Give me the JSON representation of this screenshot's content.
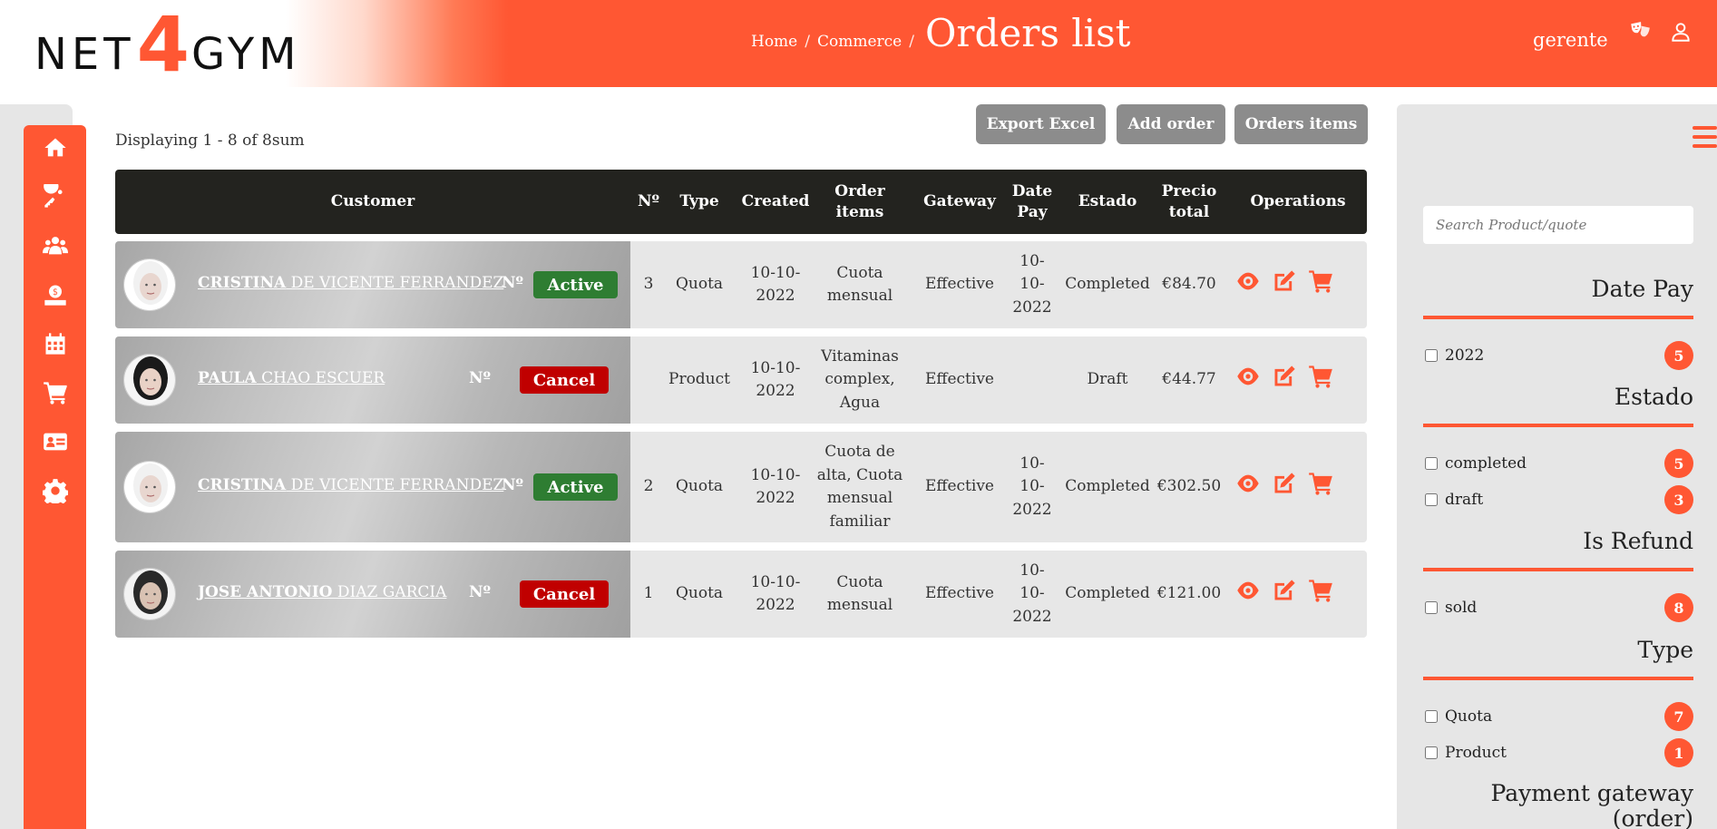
{
  "brand": {
    "part1": "NET",
    "part2": "4",
    "part3": "GYM",
    "accent_color": "#ff5733"
  },
  "header": {
    "breadcrumb": [
      {
        "label": "Home"
      },
      {
        "label": "Commerce"
      }
    ],
    "breadcrumb_separator": "/",
    "title": "Orders list",
    "user_name": "gerente",
    "icons": [
      "theater-masks-icon",
      "user-icon"
    ]
  },
  "sidebar": {
    "items": [
      {
        "icon": "home-icon"
      },
      {
        "icon": "key-icon"
      },
      {
        "icon": "users-icon"
      },
      {
        "icon": "money-icon"
      },
      {
        "icon": "calendar-icon"
      },
      {
        "icon": "cart-icon"
      },
      {
        "icon": "id-card-icon"
      },
      {
        "icon": "gear-icon"
      }
    ]
  },
  "toolbar": {
    "displaying": "Displaying 1 - 8 of 8sum",
    "export_label": "Export Excel",
    "add_label": "Add order",
    "items_label": "Orders items"
  },
  "table": {
    "headers": {
      "customer": "Customer",
      "number": "Nº",
      "type": "Type",
      "created": "Created",
      "order_items": "Order items",
      "gateway": "Gateway",
      "date_pay": "Date Pay",
      "estado": "Estado",
      "total": "Precio total",
      "operations": "Operations"
    },
    "rows": [
      {
        "first": "CRISTINA",
        "last": "DE VICENTE FERRANDEZ",
        "no_label": "Nº",
        "badge": "Active",
        "badge_kind": "active",
        "number": "3",
        "type": "Quota",
        "created": "10-10-2022",
        "items": "Cuota mensual",
        "gateway": "Effective",
        "date_pay": "10-10-2022",
        "estado": "Completed",
        "total": "€84.70"
      },
      {
        "first": "PAULA",
        "last": "CHAO ESCUER",
        "no_label": "Nº",
        "badge": "Cancel",
        "badge_kind": "cancel",
        "number": "",
        "type": "Product",
        "created": "10-10-2022",
        "items": "Vitaminas complex, Agua",
        "gateway": "Effective",
        "date_pay": "",
        "estado": "Draft",
        "total": "€44.77"
      },
      {
        "first": "CRISTINA",
        "last": "DE VICENTE FERRANDEZ",
        "no_label": "Nº",
        "badge": "Active",
        "badge_kind": "active",
        "number": "2",
        "type": "Quota",
        "created": "10-10-2022",
        "items": "Cuota de alta, Cuota mensual familiar",
        "gateway": "Effective",
        "date_pay": "10-10-2022",
        "estado": "Completed",
        "total": "€302.50"
      },
      {
        "first": "JOSE ANTONIO",
        "last": "DIAZ GARCIA",
        "no_label": "Nº",
        "badge": "Cancel",
        "badge_kind": "cancel",
        "number": "1",
        "type": "Quota",
        "created": "10-10-2022",
        "items": "Cuota mensual",
        "gateway": "Effective",
        "date_pay": "10-10-2022",
        "estado": "Completed",
        "total": "€121.00"
      }
    ],
    "operation_icons": [
      "eye-icon",
      "edit-icon",
      "cart-icon"
    ]
  },
  "filters": {
    "search_placeholder": "Search Product/quote",
    "sections": [
      {
        "title": "Date Pay",
        "options": [
          {
            "label": "2022",
            "count": "5"
          }
        ]
      },
      {
        "title": "Estado",
        "options": [
          {
            "label": "completed",
            "count": "5"
          },
          {
            "label": "draft",
            "count": "3"
          }
        ]
      },
      {
        "title": "Is Refund",
        "options": [
          {
            "label": "sold",
            "count": "8"
          }
        ]
      },
      {
        "title": "Type",
        "options": [
          {
            "label": "Quota",
            "count": "7"
          },
          {
            "label": "Product",
            "count": "1"
          }
        ]
      },
      {
        "title": "Payment gateway (order)",
        "options": []
      }
    ]
  },
  "colors": {
    "accent": "#ff5733",
    "active": "#2e7d32",
    "cancel": "#c00000",
    "table_header": "#23231f",
    "button": "#8c8c8c"
  }
}
